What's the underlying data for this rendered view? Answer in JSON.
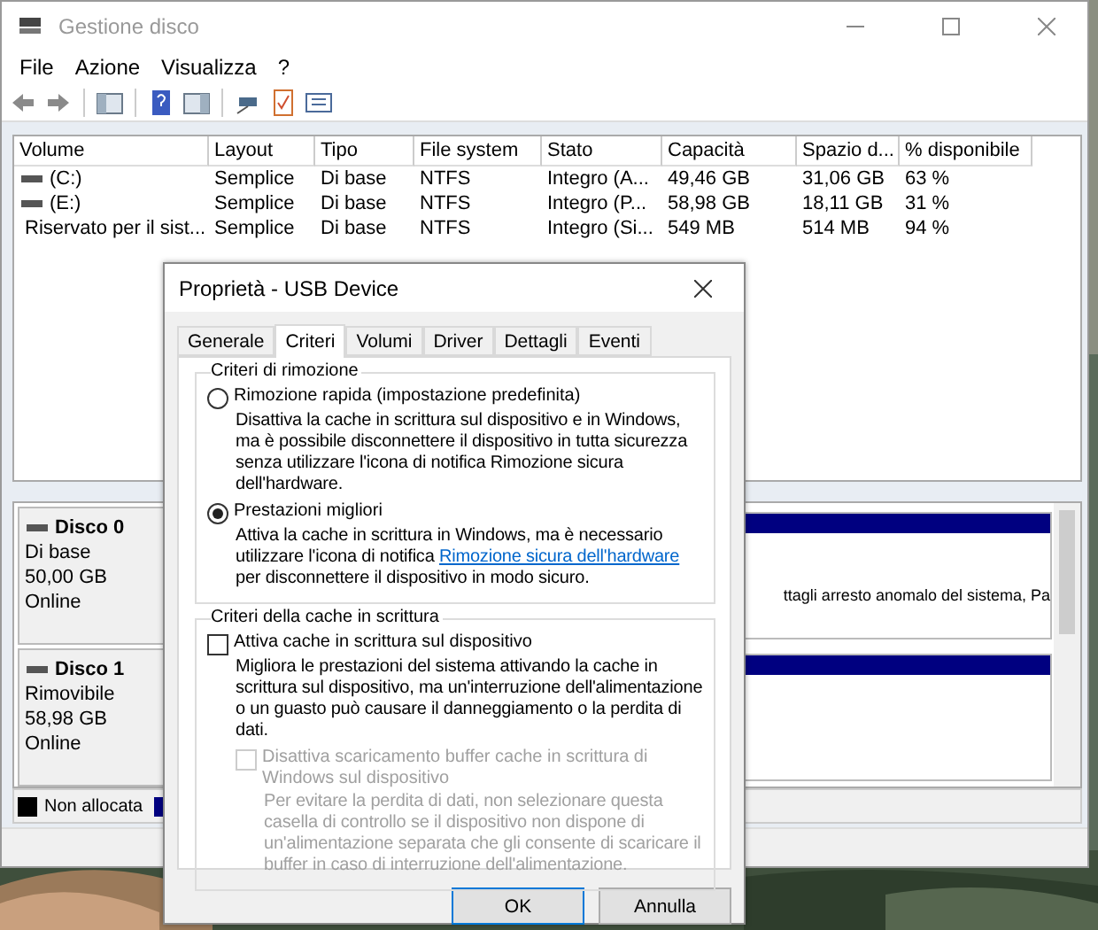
{
  "window": {
    "title": "Gestione disco"
  },
  "menu": [
    {
      "label": "File"
    },
    {
      "label": "Azione"
    },
    {
      "label": "Visualizza"
    },
    {
      "label": "?"
    }
  ],
  "volumes": {
    "columns": [
      "Volume",
      "Layout",
      "Tipo",
      "File system",
      "Stato",
      "Capacità",
      "Spazio d...",
      "% disponibile"
    ],
    "rows": [
      {
        "cells": [
          "(C:)",
          "Semplice",
          "Di base",
          "NTFS",
          "Integro (A...",
          "49,46 GB",
          "31,06 GB",
          "63 %"
        ]
      },
      {
        "cells": [
          "(E:)",
          "Semplice",
          "Di base",
          "NTFS",
          "Integro (P...",
          "58,98 GB",
          "18,11 GB",
          "31 %"
        ]
      },
      {
        "cells": [
          "Riservato per il sist...",
          "Semplice",
          "Di base",
          "NTFS",
          "Integro (Si...",
          "549 MB",
          "514 MB",
          "94 %"
        ]
      }
    ]
  },
  "disks": [
    {
      "name": "Disco 0",
      "type": "Di base",
      "size": "50,00 GB",
      "status": "Online",
      "partition_text": "ttagli arresto anomalo del sistema, Pa"
    },
    {
      "name": "Disco 1",
      "type": "Rimovibile",
      "size": "58,98 GB",
      "status": "Online"
    }
  ],
  "legend": [
    {
      "label": "Non allocata",
      "color": "#000000"
    },
    {
      "color": "#000080"
    }
  ],
  "dialog": {
    "title": "Proprietà - USB Device",
    "tabs": [
      {
        "label": "Generale",
        "selected": false
      },
      {
        "label": "Criteri",
        "selected": true
      },
      {
        "label": "Volumi",
        "selected": false
      },
      {
        "label": "Driver",
        "selected": false
      },
      {
        "label": "Dettagli",
        "selected": false
      },
      {
        "label": "Eventi",
        "selected": false
      }
    ],
    "removal_group": {
      "title": "Criteri di rimozione",
      "options": [
        {
          "label": "Rimozione rapida (impostazione predefinita)",
          "selected": false,
          "description": "Disattiva la cache in scrittura sul dispositivo e in Windows, ma è possibile disconnettere il dispositivo in tutta sicurezza senza utilizzare l'icona di notifica Rimozione sicura dell'hardware."
        },
        {
          "label": "Prestazioni migliori",
          "selected": true,
          "description": "Attiva la cache in scrittura in Windows, ma è necessario utilizzare l'icona di notifica ",
          "link": "Rimozione sicura dell'hardware",
          "description_after": " per disconnettere il dispositivo in modo sicuro."
        }
      ]
    },
    "cache_group": {
      "title": "Criteri della cache in scrittura",
      "options": [
        {
          "label": "Attiva cache in scrittura sul dispositivo",
          "checked": false,
          "disabled": false,
          "description": "Migliora le prestazioni del sistema attivando la cache in scrittura sul dispositivo, ma un'interruzione dell'alimentazione o un guasto può causare il danneggiamento o la perdita di dati."
        },
        {
          "label": "Disattiva scaricamento buffer cache in scrittura di Windows sul dispositivo",
          "checked": false,
          "disabled": true,
          "description": "Per evitare la perdita di dati, non selezionare questa casella di controllo se il dispositivo non dispone di un'alimentazione separata che gli consente di scaricare il buffer in caso di interruzione dell'alimentazione."
        }
      ]
    },
    "buttons": [
      {
        "label": "OK",
        "default": true
      },
      {
        "label": "Annulla",
        "default": false
      }
    ]
  }
}
